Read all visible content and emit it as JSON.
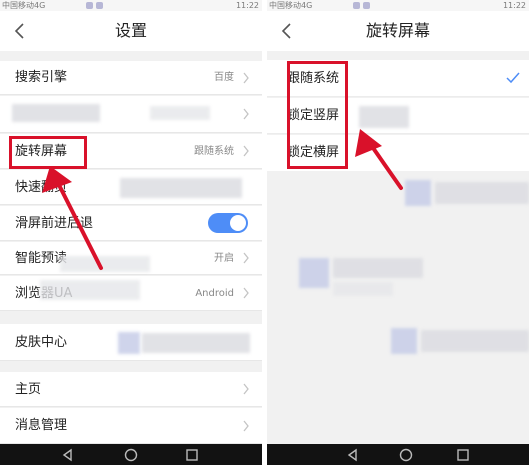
{
  "statusbar": {
    "carrier": "中国移动4G",
    "time": "11:22"
  },
  "left": {
    "title": "设置",
    "rows": [
      {
        "label": "搜索引擎",
        "value": "百度"
      },
      {
        "label": "旋转屏幕",
        "value": "跟随系统"
      },
      {
        "label": "快速翻页",
        "value": ""
      },
      {
        "label": "滑屏前进后退",
        "value": ""
      },
      {
        "label": "智能预读",
        "value": "开启"
      },
      {
        "label": "浏览器UA",
        "value": "Android"
      },
      {
        "label": "皮肤中心",
        "value": ""
      },
      {
        "label": "主页",
        "value": ""
      },
      {
        "label": "消息管理",
        "value": ""
      }
    ]
  },
  "right": {
    "title": "旋转屏幕",
    "options": [
      {
        "label": "跟随系统"
      },
      {
        "label": "锁定竖屏"
      },
      {
        "label": "锁定横屏"
      }
    ]
  },
  "colors": {
    "accent": "#4e8df7",
    "highlight": "#d9112a"
  }
}
